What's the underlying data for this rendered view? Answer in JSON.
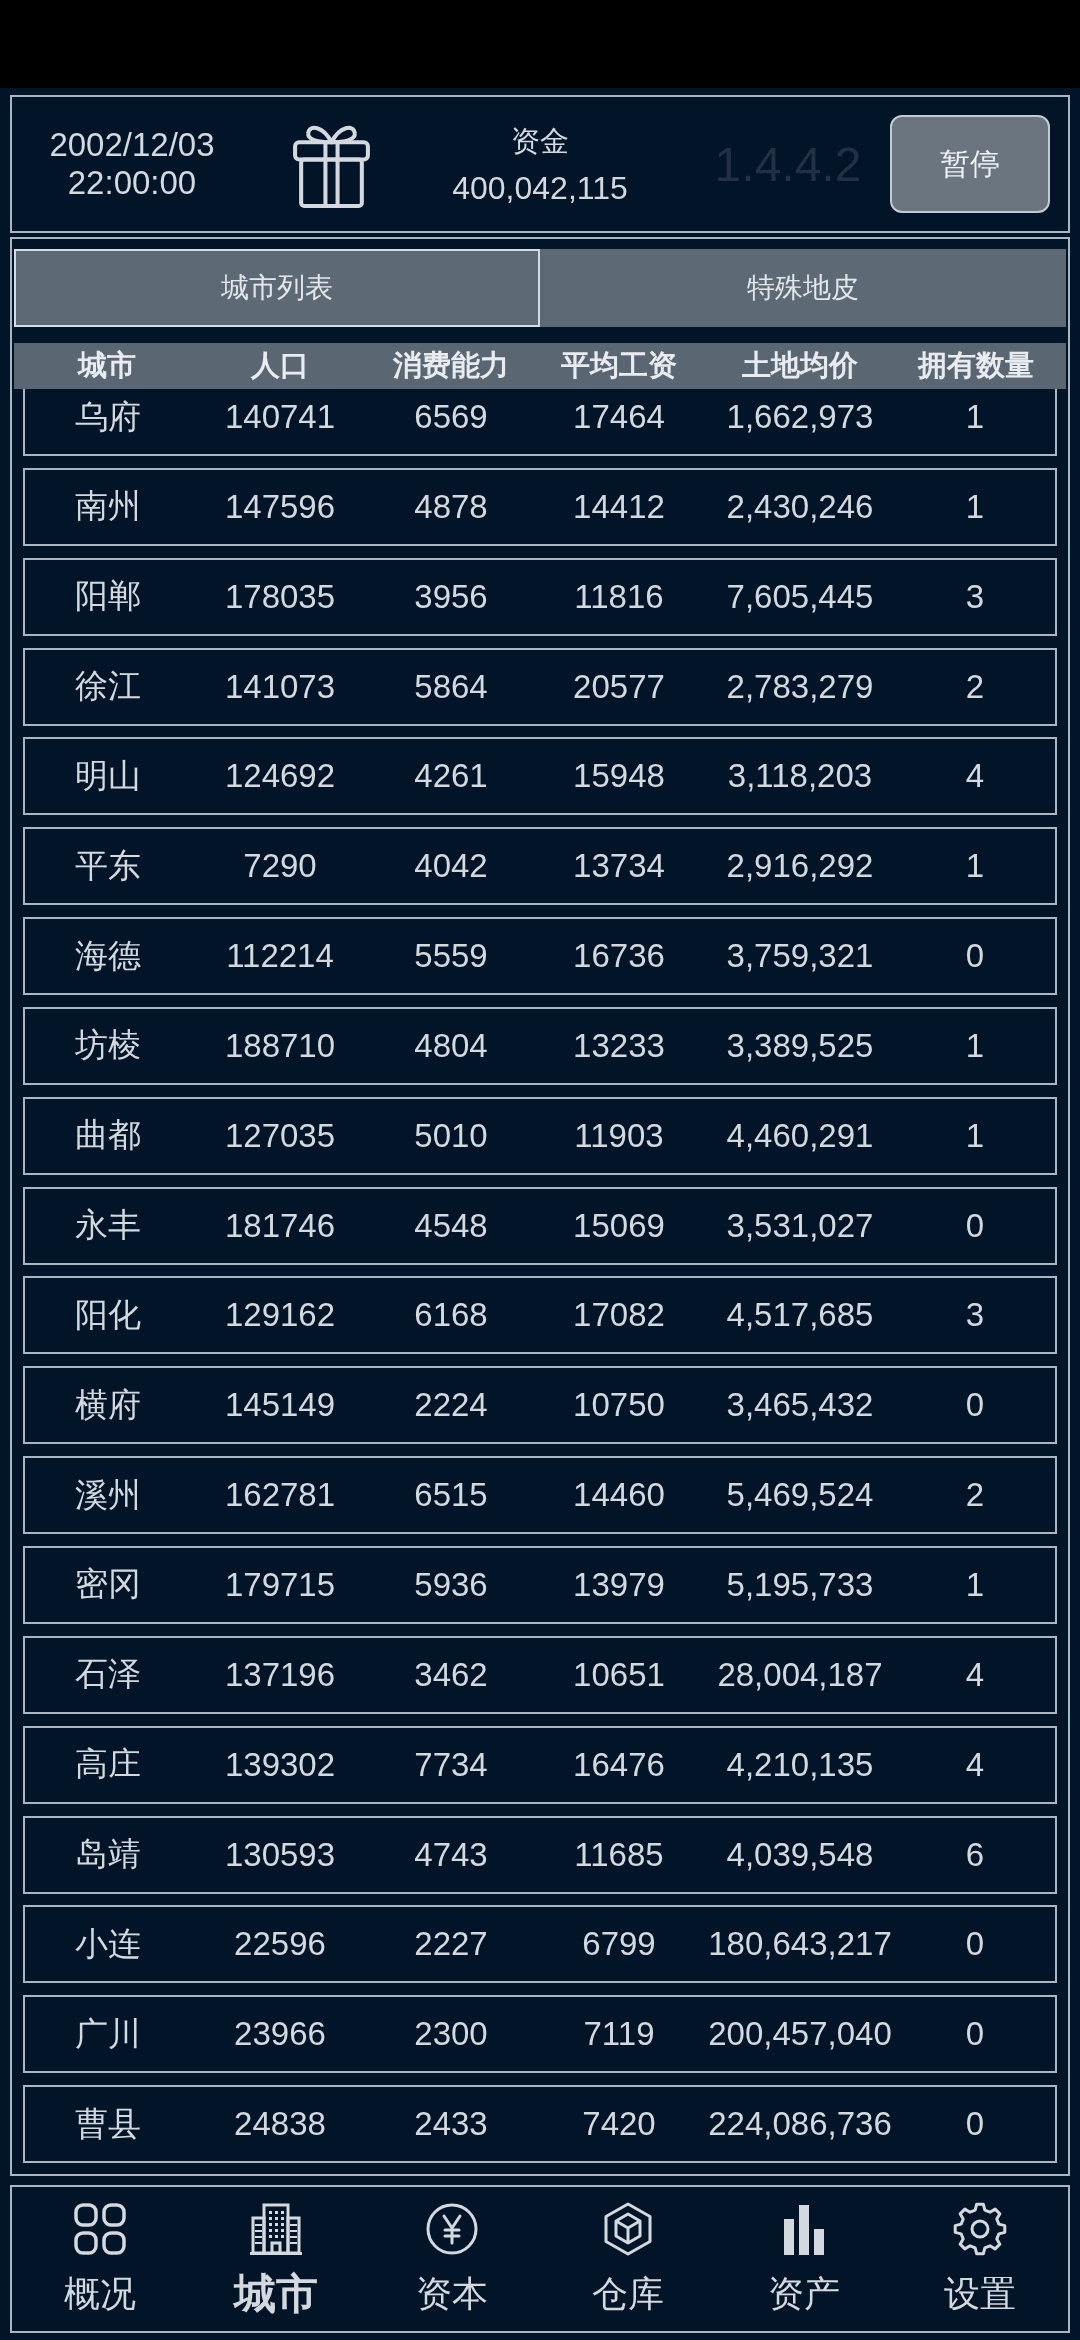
{
  "header": {
    "date": "2002/12/03",
    "time": "22:00:00",
    "funds_label": "资金",
    "funds": "400,042,115",
    "version": "1.4.4.2",
    "pause_button": "暂停"
  },
  "tabs": [
    {
      "label": "城市列表",
      "selected": true
    },
    {
      "label": "特殊地皮",
      "selected": false
    }
  ],
  "table": {
    "columns": [
      "城市",
      "人口",
      "消费能力",
      "平均工资",
      "土地均价",
      "拥有数量"
    ],
    "rows": [
      [
        "乌府",
        "140741",
        "6569",
        "17464",
        "1,662,973",
        "1"
      ],
      [
        "南州",
        "147596",
        "4878",
        "14412",
        "2,430,246",
        "1"
      ],
      [
        "阳郸",
        "178035",
        "3956",
        "11816",
        "7,605,445",
        "3"
      ],
      [
        "徐江",
        "141073",
        "5864",
        "20577",
        "2,783,279",
        "2"
      ],
      [
        "明山",
        "124692",
        "4261",
        "15948",
        "3,118,203",
        "4"
      ],
      [
        "平东",
        "7290",
        "4042",
        "13734",
        "2,916,292",
        "1"
      ],
      [
        "海德",
        "112214",
        "5559",
        "16736",
        "3,759,321",
        "0"
      ],
      [
        "坊棱",
        "188710",
        "4804",
        "13233",
        "3,389,525",
        "1"
      ],
      [
        "曲都",
        "127035",
        "5010",
        "11903",
        "4,460,291",
        "1"
      ],
      [
        "永丰",
        "181746",
        "4548",
        "15069",
        "3,531,027",
        "0"
      ],
      [
        "阳化",
        "129162",
        "6168",
        "17082",
        "4,517,685",
        "3"
      ],
      [
        "横府",
        "145149",
        "2224",
        "10750",
        "3,465,432",
        "0"
      ],
      [
        "溪州",
        "162781",
        "6515",
        "14460",
        "5,469,524",
        "2"
      ],
      [
        "密冈",
        "179715",
        "5936",
        "13979",
        "5,195,733",
        "1"
      ],
      [
        "石泽",
        "137196",
        "3462",
        "10651",
        "28,004,187",
        "4"
      ],
      [
        "高庄",
        "139302",
        "7734",
        "16476",
        "4,210,135",
        "4"
      ],
      [
        "岛靖",
        "130593",
        "4743",
        "11685",
        "4,039,548",
        "6"
      ],
      [
        "小连",
        "22596",
        "2227",
        "6799",
        "180,643,217",
        "0"
      ],
      [
        "广川",
        "23966",
        "2300",
        "7119",
        "200,457,040",
        "0"
      ],
      [
        "曹县",
        "24838",
        "2433",
        "7420",
        "224,086,736",
        "0"
      ]
    ]
  },
  "bottom_nav": [
    {
      "label": "概况",
      "selected": false
    },
    {
      "label": "城市",
      "selected": true
    },
    {
      "label": "资本",
      "selected": false
    },
    {
      "label": "仓库",
      "selected": false
    },
    {
      "label": "资产",
      "selected": false
    },
    {
      "label": "设置",
      "selected": false
    }
  ]
}
